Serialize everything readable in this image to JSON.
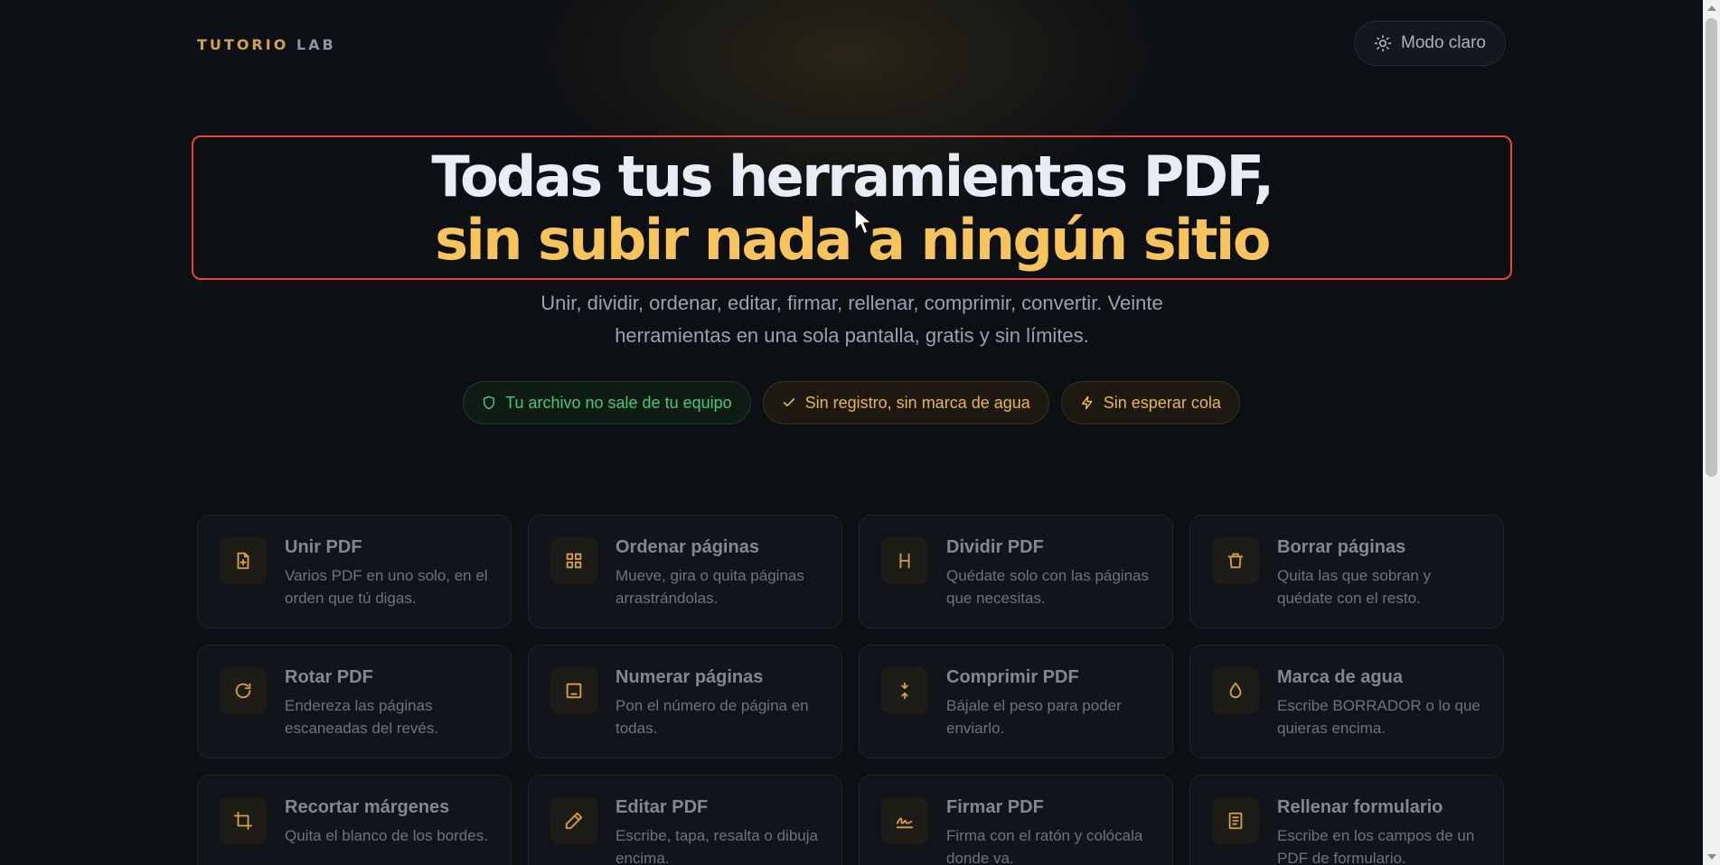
{
  "header": {
    "brand_first": "TUTORIO",
    "brand_second": "LAB",
    "theme_button_label": "Modo claro",
    "theme_icon": "sun-icon"
  },
  "hero": {
    "line1": "Todas tus herramientas PDF,",
    "line2": "sin subir nada a ningún sitio",
    "subtitle": "Unir, dividir, ordenar, editar, firmar, rellenar, comprimir, convertir. Veinte herramientas en una sola pantalla, gratis y sin límites."
  },
  "badges": [
    {
      "label": "Tu archivo no sale de tu equipo",
      "icon": "shield-icon",
      "tone": "green"
    },
    {
      "label": "Sin registro, sin marca de agua",
      "icon": "check-icon",
      "tone": "amber"
    },
    {
      "label": "Sin esperar cola",
      "icon": "lightning-icon",
      "tone": "amber"
    }
  ],
  "tools": [
    {
      "title": "Unir PDF",
      "desc": "Varios PDF en uno solo, en el orden que tú digas.",
      "icon": "file-plus-icon"
    },
    {
      "title": "Ordenar páginas",
      "desc": "Mueve, gira o quita páginas arrastrándolas.",
      "icon": "grid-icon"
    },
    {
      "title": "Dividir PDF",
      "desc": "Quédate solo con las páginas que necesitas.",
      "icon": "split-icon"
    },
    {
      "title": "Borrar páginas",
      "desc": "Quita las que sobran y quédate con el resto.",
      "icon": "trash-icon"
    },
    {
      "title": "Rotar PDF",
      "desc": "Endereza las páginas escaneadas del revés.",
      "icon": "rotate-icon"
    },
    {
      "title": "Numerar páginas",
      "desc": "Pon el número de página en todas.",
      "icon": "page-number-icon"
    },
    {
      "title": "Comprimir PDF",
      "desc": "Bájale el peso para poder enviarlo.",
      "icon": "compress-icon"
    },
    {
      "title": "Marca de agua",
      "desc": "Escribe BORRADOR o lo que quieras encima.",
      "icon": "droplet-icon"
    },
    {
      "title": "Recortar márgenes",
      "desc": "Quita el blanco de los bordes.",
      "icon": "crop-icon"
    },
    {
      "title": "Editar PDF",
      "desc": "Escribe, tapa, resalta o dibuja encima.",
      "icon": "pencil-icon"
    },
    {
      "title": "Firmar PDF",
      "desc": "Firma con el ratón y colócala donde va.",
      "icon": "signature-icon"
    },
    {
      "title": "Rellenar formulario",
      "desc": "Escribe en los campos de un PDF de formulario.",
      "icon": "form-icon"
    }
  ],
  "colors": {
    "accent": "#f7c35c",
    "brand": "#d3a14a",
    "hero_highlight_border": "#e5443d",
    "badge_green": "#4fc579",
    "background": "#0c0f14"
  }
}
